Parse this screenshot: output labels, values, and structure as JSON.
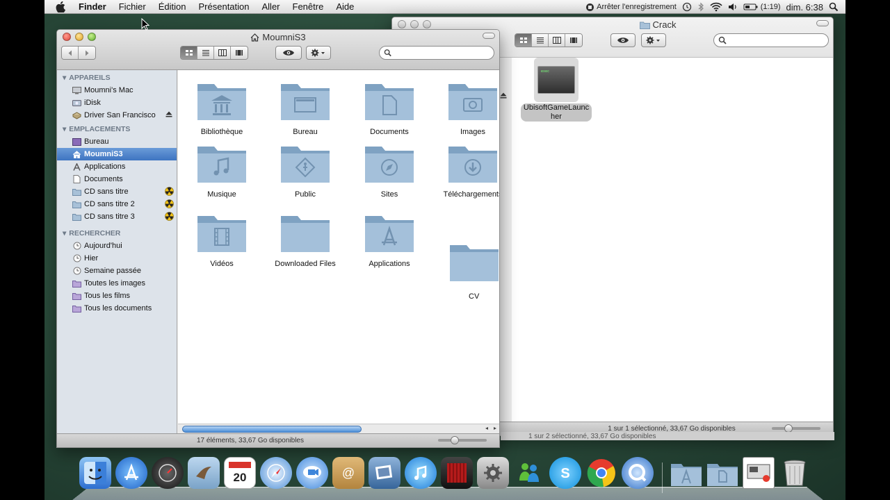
{
  "menubar": {
    "app": "Finder",
    "items": [
      "Fichier",
      "Édition",
      "Présentation",
      "Aller",
      "Fenêtre",
      "Aide"
    ],
    "status": {
      "recording": "Arrêter l'enregistrement",
      "battery": "(1:19)",
      "clock": "dim. 6:38"
    }
  },
  "back_window": {
    "title": "Crack",
    "file": {
      "name_line1": "UbisoftGameLaunc",
      "name_line2": "her"
    },
    "status_text": "1 sur 1 sélectionné, 33,67 Go disponibles",
    "behind_status_text": "1 sur 2 sélectionné, 33,67 Go disponibles"
  },
  "front_window": {
    "title": "MoumniS3",
    "sidebar": {
      "devices_header": "APPAREILS",
      "devices": [
        "Moumni's Mac",
        "iDisk",
        "Driver San Francisco"
      ],
      "places_header": "EMPLACEMENTS",
      "places": [
        "Bureau",
        "MoumniS3",
        "Applications",
        "Documents",
        "CD sans titre",
        "CD sans titre 2",
        "CD sans titre 3"
      ],
      "search_header": "RECHERCHER",
      "searches": [
        "Aujourd'hui",
        "Hier",
        "Semaine passée",
        "Toutes les images",
        "Tous les films",
        "Tous les documents"
      ]
    },
    "folders": [
      "Bibliothèque",
      "Bureau",
      "Documents",
      "Images",
      "Musique",
      "Public",
      "Sites",
      "Téléchargements",
      "Vidéos",
      "Downloaded Files",
      "Applications",
      "CV"
    ],
    "status_text": "17 éléments, 33,67 Go disponibles"
  },
  "colors": {
    "selection": "#3e74c1",
    "folder_blue": "#9cb9d3"
  }
}
